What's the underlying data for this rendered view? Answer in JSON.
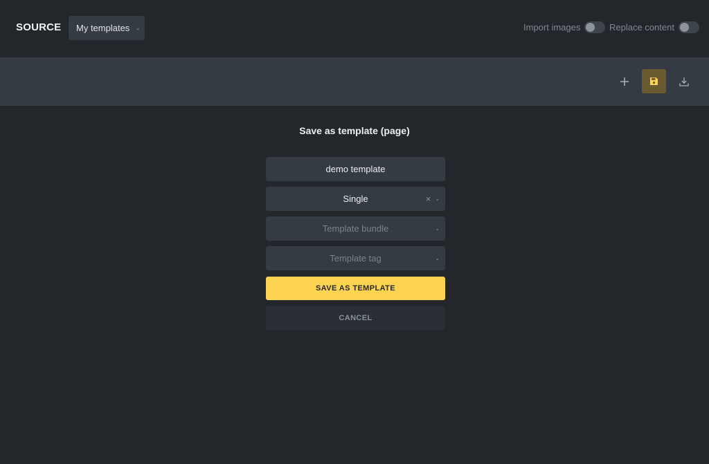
{
  "header": {
    "brand": "SOURCE",
    "source_select": {
      "value": "My templates"
    },
    "toggles": [
      {
        "label": "Import images",
        "on": false
      },
      {
        "label": "Replace content",
        "on": false
      }
    ]
  },
  "toolbar": {
    "icons": [
      "plus-icon",
      "save-icon",
      "download-icon"
    ],
    "active": "save-icon",
    "accent": "#fdd451"
  },
  "dialog": {
    "title": "Save as template (page)",
    "name_field": {
      "value": "demo template"
    },
    "type_select": {
      "value": "Single"
    },
    "bundle_select": {
      "placeholder": "Template bundle"
    },
    "tag_select": {
      "placeholder": "Template tag"
    },
    "save_label": "SAVE AS TEMPLATE",
    "cancel_label": "CANCEL"
  }
}
